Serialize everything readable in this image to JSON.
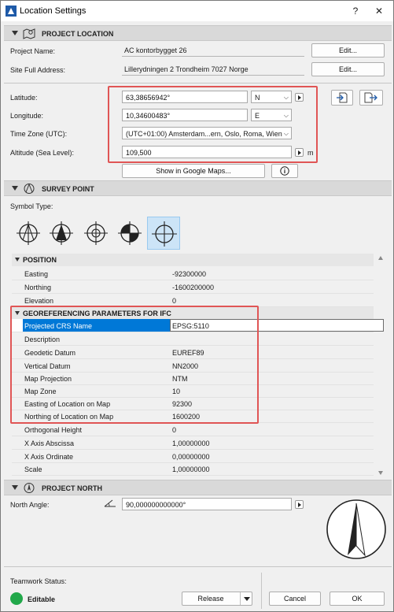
{
  "window": {
    "title": "Location Settings",
    "help": "?",
    "close": "✕"
  },
  "project_location": {
    "header": "PROJECT LOCATION",
    "project_name_label": "Project Name:",
    "project_name": "AC kontorbygget 26",
    "site_address_label": "Site Full Address:",
    "site_address": "Lillerydningen 2 Trondheim 7027 Norge",
    "edit_label": "Edit...",
    "latitude_label": "Latitude:",
    "latitude": "63,38656942°",
    "lat_dir": "N",
    "longitude_label": "Longitude:",
    "longitude": "10,34600483°",
    "lon_dir": "E",
    "timezone_label": "Time Zone (UTC):",
    "timezone": "(UTC+01:00) Amsterdam...ern, Oslo, Roma, Wien",
    "altitude_label": "Altitude (Sea Level):",
    "altitude": "109,500",
    "altitude_unit": "m",
    "google_maps": "Show in Google Maps..."
  },
  "survey_point": {
    "header": "SURVEY POINT",
    "symbol_type_label": "Symbol Type:",
    "symbols": [
      "survey-symbol-1",
      "survey-symbol-2",
      "survey-symbol-3",
      "survey-symbol-4",
      "survey-symbol-5"
    ],
    "selected_symbol": 4,
    "position_group": "POSITION",
    "position": [
      {
        "k": "Easting",
        "v": "-92300000"
      },
      {
        "k": "Northing",
        "v": "-1600200000"
      },
      {
        "k": "Elevation",
        "v": "0"
      }
    ],
    "georef_group": "GEOREFERENCING PARAMETERS FOR IFC",
    "georef": [
      {
        "k": "Projected CRS Name",
        "v": "EPSG:5110"
      },
      {
        "k": "Description",
        "v": ""
      },
      {
        "k": "Geodetic Datum",
        "v": "EUREF89"
      },
      {
        "k": "Vertical Datum",
        "v": "NN2000"
      },
      {
        "k": "Map Projection",
        "v": "NTM"
      },
      {
        "k": "Map Zone",
        "v": "10"
      },
      {
        "k": "Easting of Location on Map",
        "v": "92300"
      },
      {
        "k": "Northing of Location on Map",
        "v": "1600200"
      }
    ],
    "other": [
      {
        "k": "Orthogonal Height",
        "v": "0"
      },
      {
        "k": "X Axis Abscissa",
        "v": "1,00000000"
      },
      {
        "k": "X Axis Ordinate",
        "v": "0,00000000"
      },
      {
        "k": "Scale",
        "v": "1,00000000"
      }
    ]
  },
  "project_north": {
    "header": "PROJECT NORTH",
    "north_angle_label": "North Angle:",
    "north_angle": "90,000000000000°"
  },
  "footer": {
    "teamwork_label": "Teamwork Status:",
    "status": "Editable",
    "status_color": "#22a84a",
    "release": "Release",
    "cancel": "Cancel",
    "ok": "OK"
  },
  "colors": {
    "highlight": "#0078d7",
    "red_annotation": "#e05555"
  }
}
